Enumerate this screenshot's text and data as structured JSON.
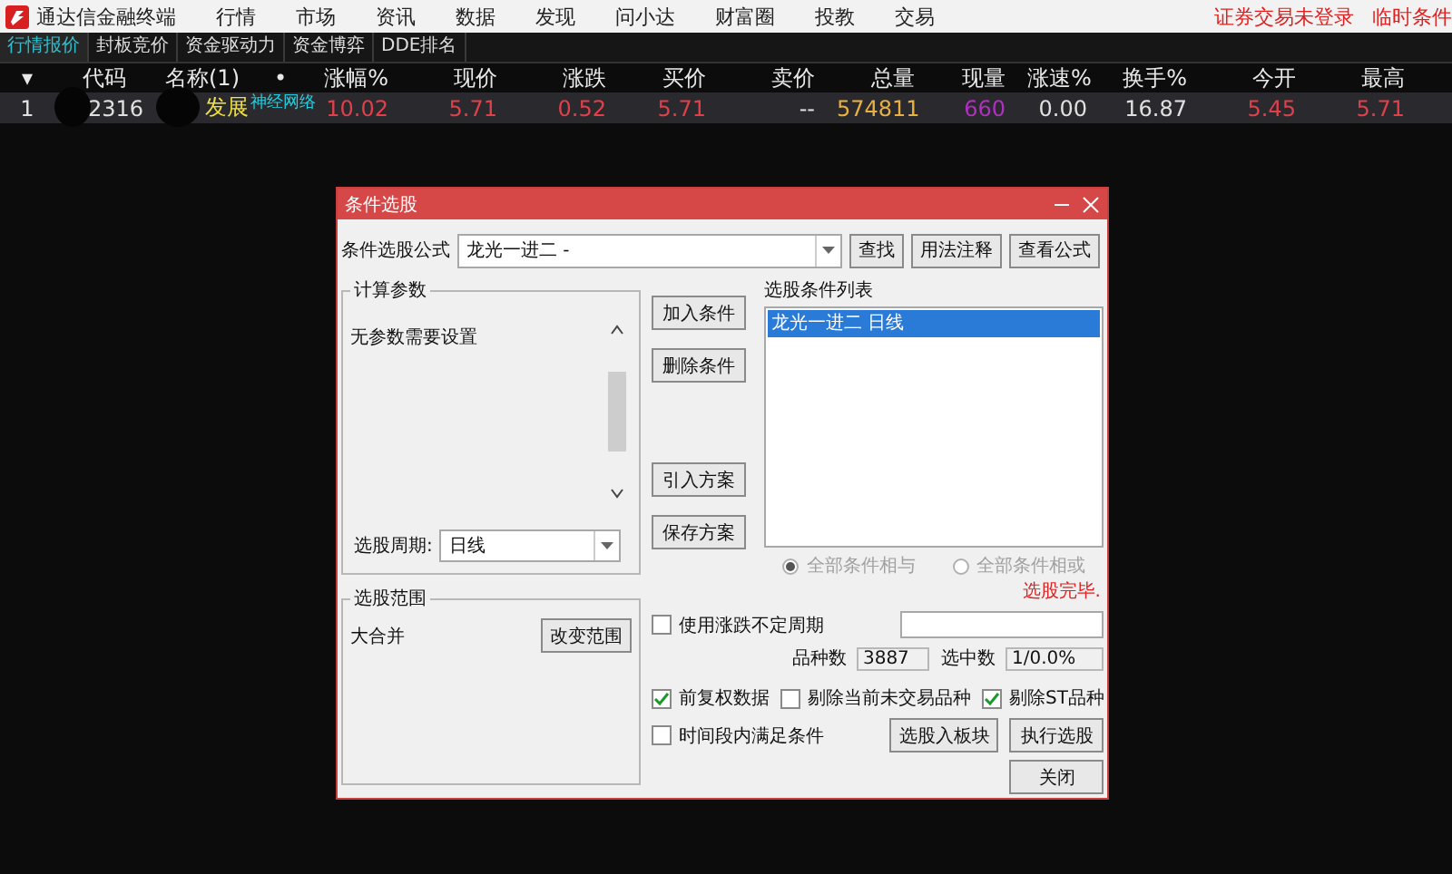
{
  "menu_bar": {
    "app_title": "通达信金融终端",
    "items": [
      "行情",
      "市场",
      "资讯",
      "数据",
      "发现",
      "问小达",
      "财富圈",
      "投教",
      "交易"
    ],
    "status": [
      "证券交易未登录",
      "临时条件"
    ]
  },
  "tabs": [
    {
      "label": "行情报价",
      "selected": true
    },
    {
      "label": "封板竞价",
      "selected": false
    },
    {
      "label": "资金驱动力",
      "selected": false
    },
    {
      "label": "资金博弈",
      "selected": false
    },
    {
      "label": "DDE排名",
      "selected": false
    }
  ],
  "quote_table": {
    "columns": [
      "▾",
      "代码",
      "名称(1)",
      "•",
      "涨幅%",
      "现价",
      "涨跌",
      "买价",
      "卖价",
      "总量",
      "现量",
      "涨速%",
      "换手%",
      "今开",
      "最高"
    ],
    "rows": [
      {
        "cells": [
          {
            "text": "1",
            "color": "#e0e0e0"
          },
          {
            "text": "2316",
            "color": "#e0e0e0"
          },
          {
            "text": "发展",
            "color": "#f0e040",
            "tag": "神经网络"
          },
          {
            "text": ""
          },
          {
            "text": "10.02",
            "color": "#e0404a"
          },
          {
            "text": "5.71",
            "color": "#e0404a"
          },
          {
            "text": "0.52",
            "color": "#e0404a"
          },
          {
            "text": "5.71",
            "color": "#e0404a"
          },
          {
            "text": "--",
            "color": "#e0e0e0"
          },
          {
            "text": "574811",
            "color": "#e8b040"
          },
          {
            "text": "660",
            "color": "#b030c0"
          },
          {
            "text": "0.00",
            "color": "#e0e0e0"
          },
          {
            "text": "16.87",
            "color": "#e0e0e0"
          },
          {
            "text": "5.45",
            "color": "#e0404a"
          },
          {
            "text": "5.71",
            "color": "#e0404a"
          }
        ]
      }
    ]
  },
  "dialog": {
    "title": "条件选股",
    "formula_label": "条件选股公式",
    "formula_value": "龙光一进二  -",
    "top_buttons": [
      "查找",
      "用法注释",
      "查看公式"
    ],
    "params_group": {
      "title": "计算参数",
      "text": "无参数需要设置"
    },
    "period_label": "选股周期:",
    "period_value": "日线",
    "action_buttons": [
      "加入条件",
      "删除条件",
      "引入方案",
      "保存方案"
    ],
    "list_title": "选股条件列表",
    "conditions": [
      {
        "label": "龙光一进二  日线",
        "selected": true
      }
    ],
    "logic_options": [
      {
        "label": "全部条件相与",
        "selected": true,
        "disabled": true
      },
      {
        "label": "全部条件相或",
        "selected": false,
        "disabled": true
      }
    ],
    "status_message": "选股完毕.",
    "use_period": {
      "label": "使用涨跌不定周期",
      "checked": false
    },
    "count_label": "品种数",
    "count_value": "3887",
    "selected_label": "选中数",
    "selected_value": "1/0.0%",
    "options": [
      {
        "label": "前复权数据",
        "checked": true
      },
      {
        "label": "剔除当前未交易品种",
        "checked": false
      },
      {
        "label": "剔除ST品种",
        "checked": true
      }
    ],
    "time_condition": {
      "label": "时间段内满足条件",
      "checked": false
    },
    "scope_group": {
      "title": "选股范围",
      "value": "大合并",
      "button": "改变范围"
    },
    "bottom_buttons": [
      "选股入板块",
      "执行选股",
      "关闭"
    ]
  }
}
